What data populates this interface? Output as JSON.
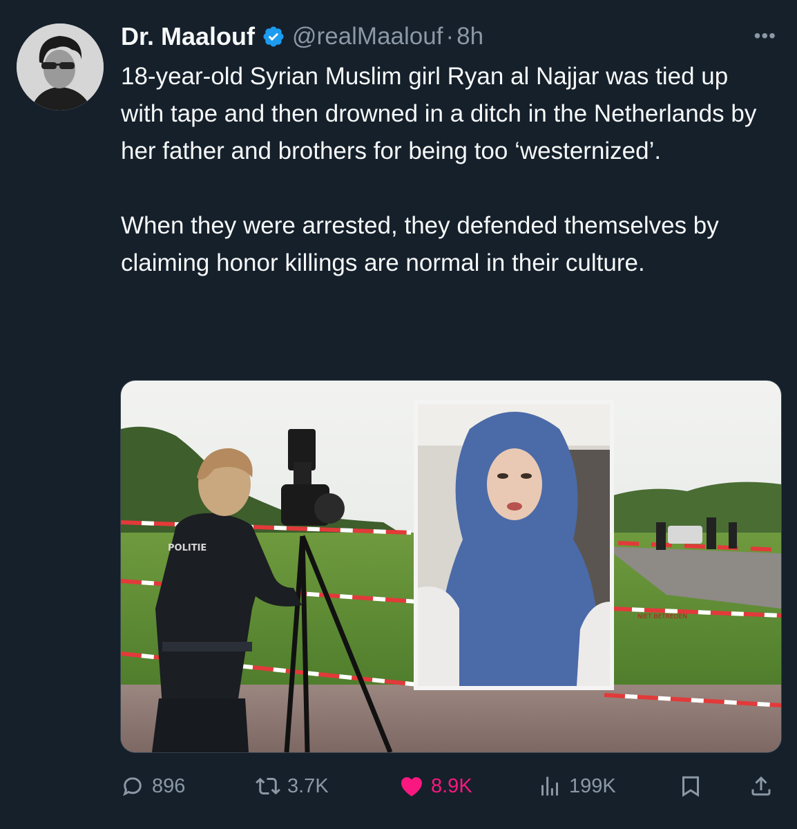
{
  "author": {
    "name": "Dr. Maalouf",
    "handle": "@realMaalouf",
    "separator": "·",
    "time": "8h",
    "verified": true,
    "avatar_alt": "profile photo"
  },
  "tweet": {
    "paragraphs": [
      "18-year-old Syrian Muslim girl Ryan al Najjar was tied up with tape and then drowned in a ditch in the Netherlands by her father and brothers for being too ‘westernized’.",
      "When they were arrested, they defended themselves by claiming honor killings are normal in their culture."
    ]
  },
  "media": {
    "police_vest_text": "POLITIE",
    "tape_text": "NIET BETREDEN"
  },
  "actions": {
    "replies": "896",
    "retweets": "3.7K",
    "likes": "8.9K",
    "views": "199K"
  },
  "icons": {
    "more": "more-icon",
    "reply": "reply-icon",
    "retweet": "retweet-icon",
    "like": "heart-icon",
    "views": "views-icon",
    "bookmark": "bookmark-icon",
    "share": "share-icon",
    "verified": "verified-badge-icon"
  },
  "colors": {
    "background": "#15202b",
    "text": "#f7f9f9",
    "muted": "#8b98a5",
    "accent": "#1d9bf0",
    "like": "#f91880"
  }
}
